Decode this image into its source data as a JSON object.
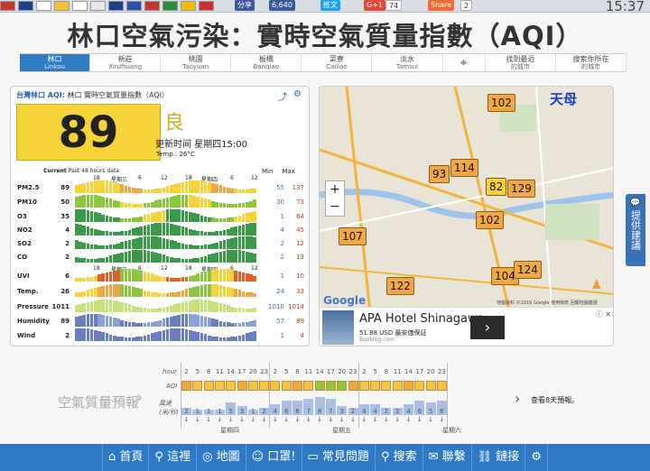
{
  "topbar": {
    "share_fb": "分享",
    "like_count": "6,640",
    "tweet": "推文",
    "gplus": "G+1",
    "gplus_count": "74",
    "share_label": "Share",
    "share_count": "2",
    "clock": "15:37"
  },
  "title": "林口空氣污染：實時空氣質量指數（AQI）",
  "nav": [
    {
      "label": "林口",
      "en": "Linkou",
      "active": true
    },
    {
      "label": "新莊",
      "en": "Xinzhuang"
    },
    {
      "label": "桃園",
      "en": "Taoyuan"
    },
    {
      "label": "板橋",
      "en": "Banqiao"
    },
    {
      "label": "菜寮",
      "en": "Cailiao"
    },
    {
      "label": "淡水",
      "en": "Tamsui"
    },
    {
      "label": "",
      "en": ""
    },
    {
      "label": "找到最近",
      "en": "的城市"
    },
    {
      "label": "搜索你所在",
      "en": "的城市"
    }
  ],
  "panel": {
    "title_bold": "台灣林口 AQI:",
    "title_rest": "林口 實時空氣質量指數（AQI）",
    "aqi": "89",
    "level": "良",
    "updated": "更新时间 星期四15:00",
    "temp": "Temp.: 26°C",
    "head_current": "Current",
    "head_past": "Past 48 hours data",
    "head_min": "Min",
    "head_max": "Max",
    "axis_top": [
      "18",
      "星期三",
      "6",
      "12",
      "18",
      "星期四",
      "6",
      "12"
    ],
    "axis_mid": [
      "18",
      "星期三",
      "6",
      "12",
      "18",
      "星期四",
      "6",
      "12"
    ],
    "rows": [
      {
        "name": "PM2.5",
        "unit": "AQI",
        "value": "89",
        "min": "55",
        "max": "137"
      },
      {
        "name": "PM10",
        "unit": "AQI",
        "value": "50",
        "min": "30",
        "max": "73"
      },
      {
        "name": "O3",
        "unit": "AQI",
        "value": "35",
        "min": "1",
        "max": "64"
      },
      {
        "name": "NO2",
        "unit": "AQI",
        "value": "4",
        "min": "4",
        "max": "45"
      },
      {
        "name": "SO2",
        "unit": "AQI",
        "value": "2",
        "min": "2",
        "max": "12"
      },
      {
        "name": "CO",
        "unit": "AQI",
        "value": "2",
        "min": "2",
        "max": "13"
      },
      {
        "name": "UVI",
        "unit": "",
        "value": "6",
        "min": "1",
        "max": "10"
      },
      {
        "name": "Temp.",
        "unit": "",
        "value": "26",
        "min": "24",
        "max": "33"
      },
      {
        "name": "Pressure",
        "unit": "",
        "value": "1011",
        "min": "1010",
        "max": "1014"
      },
      {
        "name": "Humidity",
        "unit": "",
        "value": "89",
        "min": "57",
        "max": "89"
      },
      {
        "name": "Wind",
        "unit": "",
        "value": "2",
        "min": "1",
        "max": "4"
      }
    ]
  },
  "map": {
    "tianmu": "天母",
    "markers": [
      "102",
      "93",
      "114",
      "82",
      "129",
      "102",
      "107",
      "104",
      "124",
      "122"
    ],
    "zoom_in": "+",
    "zoom_out": "−",
    "google": "Google",
    "copyright": "地圖資料 ©2016 Google  使用條款  回報地圖錯誤",
    "ad_title": "APA Hotel Shinagawa",
    "ad_price": "51.88 USD 最安価保証",
    "ad_url": "Booking.com",
    "ad_btn": "›",
    "ad_close": "ⓘ ✕"
  },
  "side_button": "提供建議",
  "forecast": {
    "label": "空氣質量預報",
    "more": "查看8天預報。",
    "row_hour": "hour",
    "row_aqi": "AQI",
    "row_wind": "風速(米/秒)",
    "hours": [
      "2",
      "5",
      "8",
      "11",
      "14",
      "17",
      "20",
      "23",
      "2",
      "5",
      "8",
      "11",
      "14",
      "17",
      "20",
      "23",
      "2",
      "5",
      "8",
      "11",
      "14",
      "17",
      "20",
      "23"
    ],
    "wind": [
      "2",
      "1",
      "1",
      "1",
      "5",
      "3",
      "1",
      "2",
      "4",
      "6",
      "6",
      "7",
      "8",
      "7",
      "3",
      "2",
      "4",
      "4",
      "2",
      "2",
      "4",
      "6",
      "5",
      "6"
    ],
    "days": [
      "星期四",
      "星期五",
      "星期六"
    ]
  },
  "bottom_nav": [
    "首頁",
    "這裡",
    "地圖",
    "口罩!",
    "常見問題",
    "搜索",
    "聯繫",
    "鏈接",
    "⚙"
  ]
}
